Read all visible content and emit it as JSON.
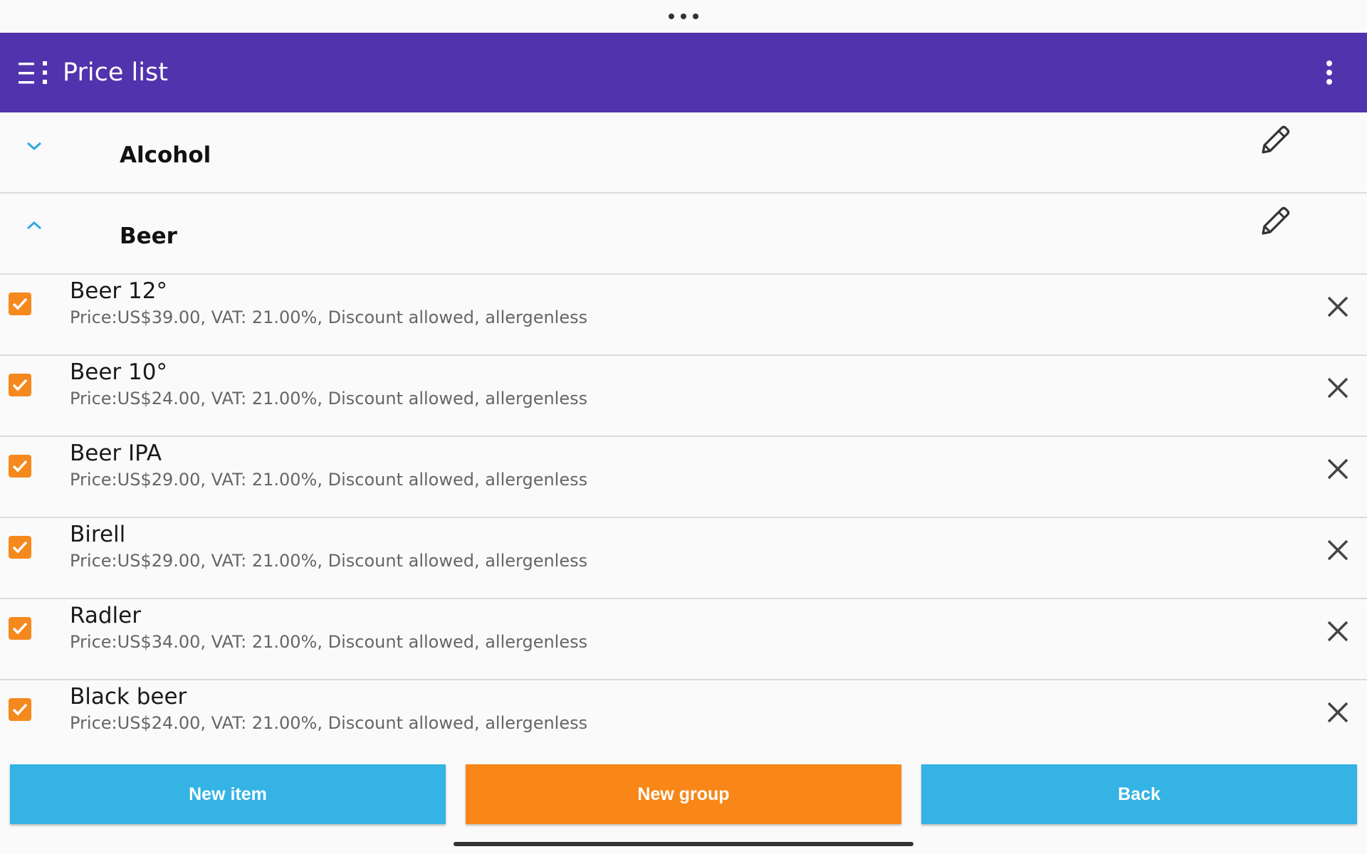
{
  "toolbar": {
    "title": "Price list",
    "menu_icon": "list-menu-icon",
    "overflow_icon": "more-vert-icon"
  },
  "groups": [
    {
      "label": "Alcohol",
      "expanded": false
    },
    {
      "label": "Beer",
      "expanded": true
    }
  ],
  "items": [
    {
      "name": "Beer 12°",
      "details": "Price:US$39.00, VAT: 21.00%, Discount allowed, allergenless",
      "checked": true
    },
    {
      "name": "Beer 10°",
      "details": "Price:US$24.00, VAT: 21.00%, Discount allowed, allergenless",
      "checked": true
    },
    {
      "name": "Beer IPA",
      "details": "Price:US$29.00, VAT: 21.00%, Discount allowed, allergenless",
      "checked": true
    },
    {
      "name": "Birell",
      "details": "Price:US$29.00, VAT: 21.00%, Discount allowed, allergenless",
      "checked": true
    },
    {
      "name": "Radler",
      "details": "Price:US$34.00, VAT: 21.00%, Discount allowed, allergenless",
      "checked": true
    },
    {
      "name": "Black beer",
      "details": "Price:US$24.00, VAT: 21.00%, Discount allowed, allergenless",
      "checked": true
    }
  ],
  "buttons": {
    "new_item": "New item",
    "new_group": "New group",
    "back": "Back"
  },
  "colors": {
    "toolbar": "#5133ad",
    "accent_blue": "#34b3e4",
    "accent_orange": "#f88718",
    "chevron": "#2ea8df"
  }
}
